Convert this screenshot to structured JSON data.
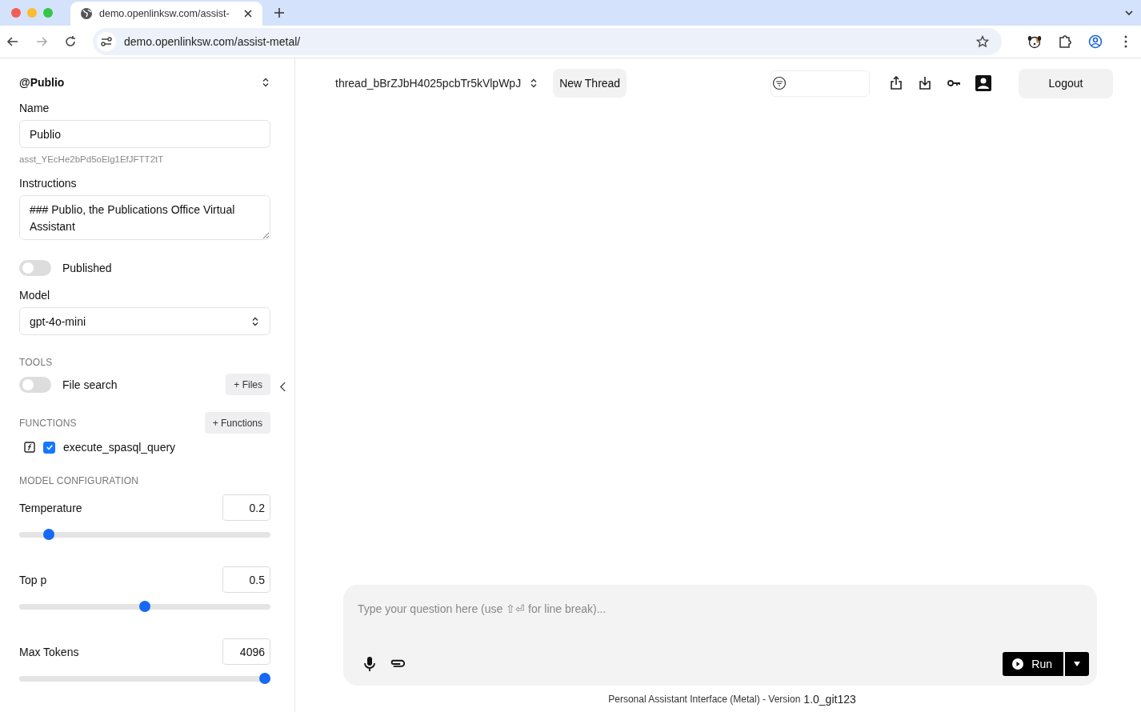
{
  "browser": {
    "tab_title": "demo.openlinksw.com/assist-",
    "url": "demo.openlinksw.com/assist-metal/"
  },
  "sidebar": {
    "assistant": "@Publio",
    "name_label": "Name",
    "name_value": "Publio",
    "assistant_id": "asst_YEcHe2bPd5oElg1EfJFTT2tT",
    "instructions_label": "Instructions",
    "instructions_value": "### Publio, the Publications Office Virtual Assistant",
    "published": {
      "label": "Published",
      "on": false
    },
    "model_label": "Model",
    "model_value": "gpt-4o-mini",
    "tools_heading": "TOOLS",
    "file_search": {
      "label": "File search",
      "on": false
    },
    "files_button": "+ Files",
    "functions_heading": "FUNCTIONS",
    "functions_button": "+ Functions",
    "functions": [
      {
        "name": "execute_spasql_query",
        "checked": true
      }
    ],
    "config_heading": "MODEL CONFIGURATION",
    "params": [
      {
        "label": "Temperature",
        "value": "0.2",
        "level": 0.1
      },
      {
        "label": "Top p",
        "value": "0.5",
        "level": 0.5
      },
      {
        "label": "Max Tokens",
        "value": "4096",
        "level": 1
      }
    ]
  },
  "header": {
    "thread": "thread_bBrZJbH4025pcbTr5kVlpWpJ",
    "new_thread": "New Thread",
    "logout": "Logout"
  },
  "composer": {
    "placeholder": "Type your question here (use ⇧⏎ for line break)...",
    "run": "Run"
  },
  "footer": {
    "text": "Personal Assistant Interface (Metal) - Version",
    "version": "1.0_git123"
  }
}
